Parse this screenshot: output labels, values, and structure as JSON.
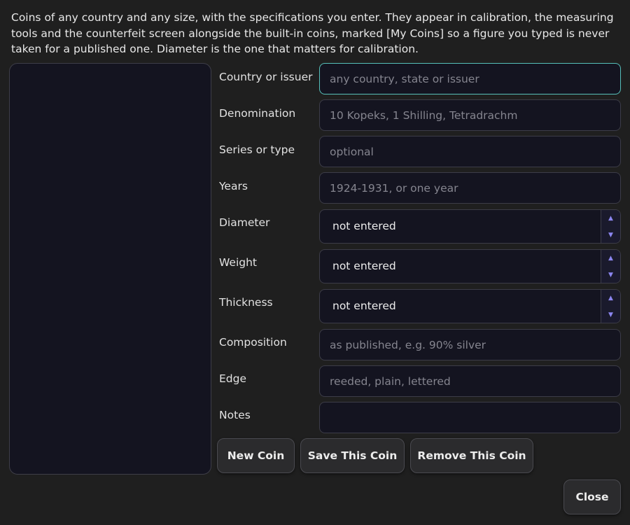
{
  "intro": {
    "text": "Coins of any country and any size, with the specifications you enter. They appear in calibration, the measuring tools and the counterfeit screen alongside the built-in coins, marked [My Coins] so a figure you typed is never taken for a published one. Diameter is the one that matters for calibration."
  },
  "form": {
    "country": {
      "label": "Country or issuer",
      "value": "",
      "placeholder": "any country, state or issuer"
    },
    "denomination": {
      "label": "Denomination",
      "value": "",
      "placeholder": "10 Kopeks, 1 Shilling, Tetradrachm"
    },
    "series": {
      "label": "Series or type",
      "value": "",
      "placeholder": "optional"
    },
    "years": {
      "label": "Years",
      "value": "",
      "placeholder": "1924-1931, or one year"
    },
    "diameter": {
      "label": "Diameter",
      "value": "not entered"
    },
    "weight": {
      "label": "Weight",
      "value": "not entered"
    },
    "thickness": {
      "label": "Thickness",
      "value": "not entered"
    },
    "composition": {
      "label": "Composition",
      "value": "",
      "placeholder": "as published, e.g. 90% silver"
    },
    "edge": {
      "label": "Edge",
      "value": "",
      "placeholder": "reeded, plain, lettered"
    },
    "notes": {
      "label": "Notes",
      "value": "",
      "placeholder": ""
    }
  },
  "buttons": {
    "new_coin": "New Coin",
    "save_coin": "Save This Coin",
    "remove_coin": "Remove This Coin",
    "close": "Close"
  },
  "icons": {
    "spin_up": "chevron-up-icon",
    "spin_down": "chevron-down-icon"
  },
  "colors": {
    "background": "#1f1f1f",
    "field_background": "#141420",
    "focus_border": "#56c0ba",
    "spin_arrow": "#8c86f0"
  }
}
